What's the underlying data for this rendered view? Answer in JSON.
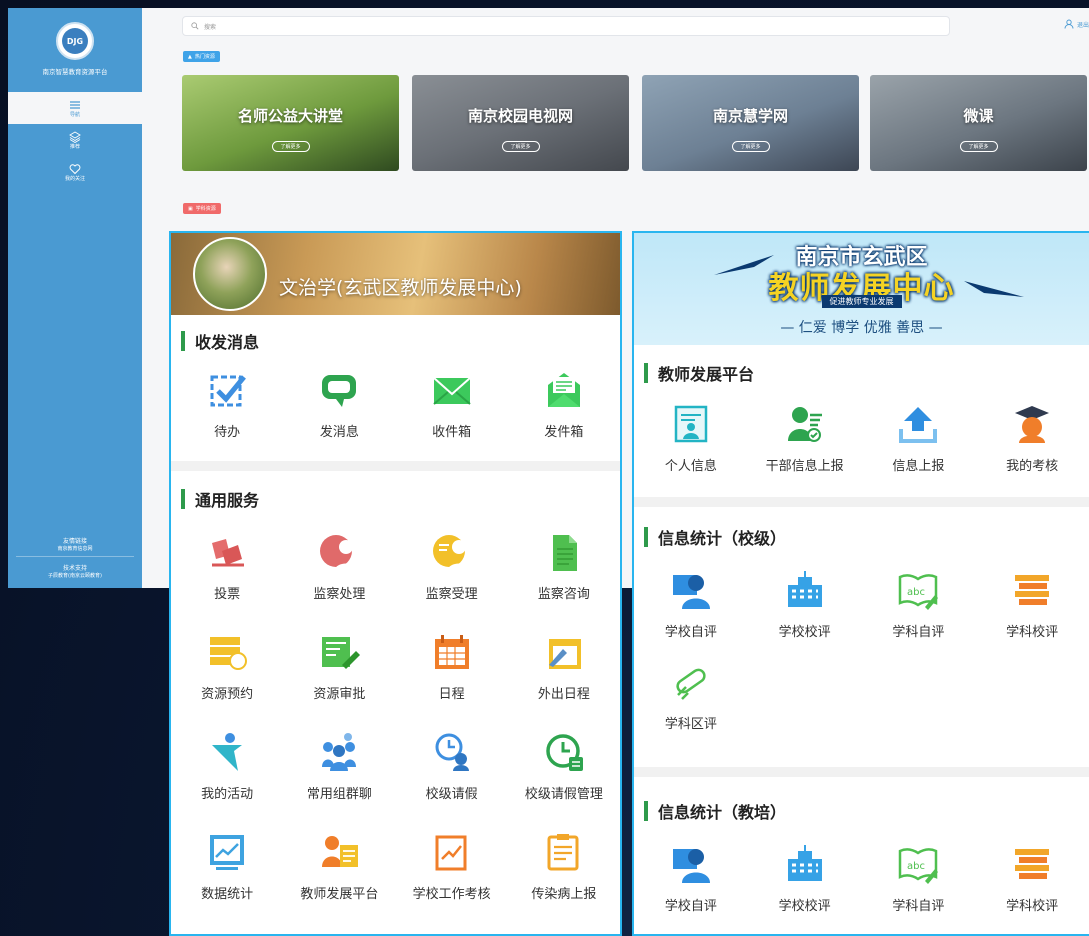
{
  "sidebar": {
    "logo_text": "DJG",
    "platform_name": "南京智慧教育资源平台",
    "nav": [
      {
        "label": "导航",
        "icon": "menu-icon",
        "active": true
      },
      {
        "label": "推荐",
        "icon": "layers-icon",
        "active": false
      },
      {
        "label": "我的关注",
        "icon": "heart-icon",
        "active": false
      }
    ],
    "footer": {
      "friend_links": "友情链接",
      "friend_link_item": "南京教育信息网",
      "tech_support": "技术支持",
      "tech_support_item": "子辰教育(南京云颐教育)"
    }
  },
  "topbar": {
    "search_placeholder": "搜索",
    "user_label": "退出"
  },
  "hot": {
    "tag": "热门资源",
    "cards": [
      {
        "title": "名师公益大讲堂",
        "more": "了解更多"
      },
      {
        "title": "南京校园电视网",
        "more": "了解更多"
      },
      {
        "title": "南京慧学网",
        "more": "了解更多"
      },
      {
        "title": "微课",
        "more": "了解更多"
      }
    ]
  },
  "subject": {
    "tag": "学科资源"
  },
  "left_panel": {
    "name": "文治学(玄武区教师发展中心)",
    "sections": [
      {
        "title": "收发消息",
        "items": [
          {
            "label": "待办",
            "icon": "checkbox-icon"
          },
          {
            "label": "发消息",
            "icon": "chat-bubble-icon"
          },
          {
            "label": "收件箱",
            "icon": "envelope-icon"
          },
          {
            "label": "发件箱",
            "icon": "open-envelope-icon"
          }
        ]
      },
      {
        "title": "通用服务",
        "items": [
          {
            "label": "投票",
            "icon": "vote-icon"
          },
          {
            "label": "监察处理",
            "icon": "supervise-icon"
          },
          {
            "label": "监察受理",
            "icon": "accept-icon"
          },
          {
            "label": "监察咨询",
            "icon": "document-icon"
          },
          {
            "label": "资源预约",
            "icon": "reservation-icon"
          },
          {
            "label": "资源审批",
            "icon": "approval-icon"
          },
          {
            "label": "日程",
            "icon": "calendar-icon"
          },
          {
            "label": "外出日程",
            "icon": "outing-calendar-icon"
          },
          {
            "label": "我的活动",
            "icon": "activity-icon"
          },
          {
            "label": "常用组群聊",
            "icon": "group-chat-icon"
          },
          {
            "label": "校级请假",
            "icon": "leave-icon"
          },
          {
            "label": "校级请假管理",
            "icon": "leave-manage-icon"
          },
          {
            "label": "数据统计",
            "icon": "chart-icon"
          },
          {
            "label": "教师发展平台",
            "icon": "teacher-icon"
          },
          {
            "label": "学校工作考核",
            "icon": "assessment-icon"
          },
          {
            "label": "传染病上报",
            "icon": "report-icon"
          }
        ]
      }
    ]
  },
  "right_panel": {
    "banner": {
      "line1": "南京市玄武区",
      "line2": "教师发展中心",
      "line3": "促进教师专业发展",
      "line4": "— 仁爱  博学  优雅  善思 —"
    },
    "sections": [
      {
        "title": "教师发展平台",
        "items": [
          {
            "label": "个人信息",
            "icon": "profile-card-icon"
          },
          {
            "label": "干部信息上报",
            "icon": "cadre-icon"
          },
          {
            "label": "信息上报",
            "icon": "upload-icon"
          },
          {
            "label": "我的考核",
            "icon": "graduate-icon"
          }
        ]
      },
      {
        "title": "信息统计（校级）",
        "items": [
          {
            "label": "学校自评",
            "icon": "self-eval-icon"
          },
          {
            "label": "学校校评",
            "icon": "school-building-icon"
          },
          {
            "label": "学科自评",
            "icon": "abc-book-icon"
          },
          {
            "label": "学科校评",
            "icon": "books-icon"
          },
          {
            "label": "学科区评",
            "icon": "diploma-icon"
          }
        ]
      },
      {
        "title": "信息统计（教培）",
        "items": [
          {
            "label": "学校自评",
            "icon": "self-eval-icon"
          },
          {
            "label": "学校校评",
            "icon": "school-building-icon"
          },
          {
            "label": "学科自评",
            "icon": "abc-book-icon"
          },
          {
            "label": "学科校评",
            "icon": "books-icon"
          }
        ]
      }
    ]
  }
}
